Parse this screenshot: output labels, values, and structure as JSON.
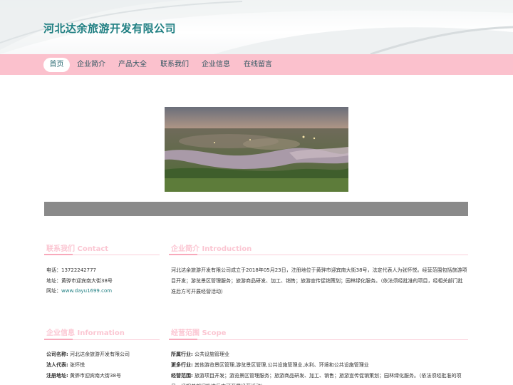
{
  "site": {
    "title": "河北达余旅游开发有限公司"
  },
  "nav": {
    "items": [
      {
        "label": "首页"
      },
      {
        "label": "企业简介"
      },
      {
        "label": "产品大全"
      },
      {
        "label": "联系我们"
      },
      {
        "label": "企业信息"
      },
      {
        "label": "在线留言"
      }
    ],
    "active_index": 0
  },
  "contact": {
    "title": "联系我们 Contact",
    "phone_label": "电话：",
    "phone": "13722242777",
    "address_label": "地址：",
    "address": "黄骅市迎宾南大街38号",
    "website_label": "网址：",
    "website": "www.dayu1699.com"
  },
  "intro": {
    "title": "企业简介 Introduction",
    "text": "河北达余旅游开发有限公司成立于2018年05月23日，注册地位于黄骅市迎宾南大街38号，法定代表人为张怀悦。经营范围包括旅游项目开发；游览景区管理服务；旅游商品研发、加工、销售；旅游宣传促销策划；园林绿化服务。（依法须经批准的项目，经相关部门批准后方可开展经营活动）"
  },
  "info": {
    "title": "企业信息 Information",
    "company_label": "公司名称:",
    "company": "河北达余旅游开发有限公司",
    "legal_label": "法人代表:",
    "legal": "张怀悦",
    "reg_address_label": "注册地址:",
    "reg_address": "黄骅市迎宾南大街38号"
  },
  "scope": {
    "title": "经营范围 Scope",
    "industry_label": "所属行业:",
    "industry": "公共设施管理业",
    "more_label": "更多行业:",
    "more": "其他游览景区管理,游览景区管理,公共设施管理业,水利、环境和公共设施管理业",
    "range_label": "经营范围:",
    "range": "旅游项目开发；游览景区管理服务；旅游商品研发、加工、销售；旅游宣传促销策划；园林绿化服务。（依法须经批准的项目，经相关部门批准后方可开展经营活动）"
  },
  "colors": {
    "nav_bg": "#fbc1cd",
    "title": "#1f7f82",
    "section_title": "#fbc6d2",
    "gray_bar": "#8a8a8a"
  }
}
